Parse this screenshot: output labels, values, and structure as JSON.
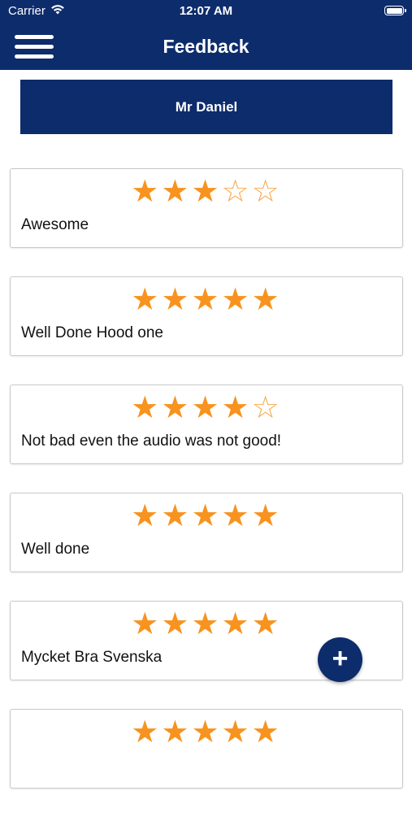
{
  "status_bar": {
    "carrier": "Carrier",
    "time": "12:07 AM",
    "wifi_icon": "wifi-icon",
    "battery_icon": "battery-icon"
  },
  "nav": {
    "title": "Feedback",
    "menu_icon": "hamburger-menu-icon"
  },
  "banner": {
    "name": "Mr Daniel"
  },
  "feedback": [
    {
      "rating": 3,
      "max": 5,
      "comment": "Awesome"
    },
    {
      "rating": 5,
      "max": 5,
      "comment": "Well Done Hood one"
    },
    {
      "rating": 4,
      "max": 5,
      "comment": "Not bad even the audio was not good!"
    },
    {
      "rating": 5,
      "max": 5,
      "comment": "Well done"
    },
    {
      "rating": 5,
      "max": 5,
      "comment": "Mycket Bra Svenska"
    },
    {
      "rating": 5,
      "max": 5,
      "comment": ""
    }
  ],
  "fab": {
    "label": "+",
    "icon": "plus-icon"
  },
  "colors": {
    "primary": "#0d2c6c",
    "star": "#f7931e",
    "border": "#c8c8c8"
  }
}
